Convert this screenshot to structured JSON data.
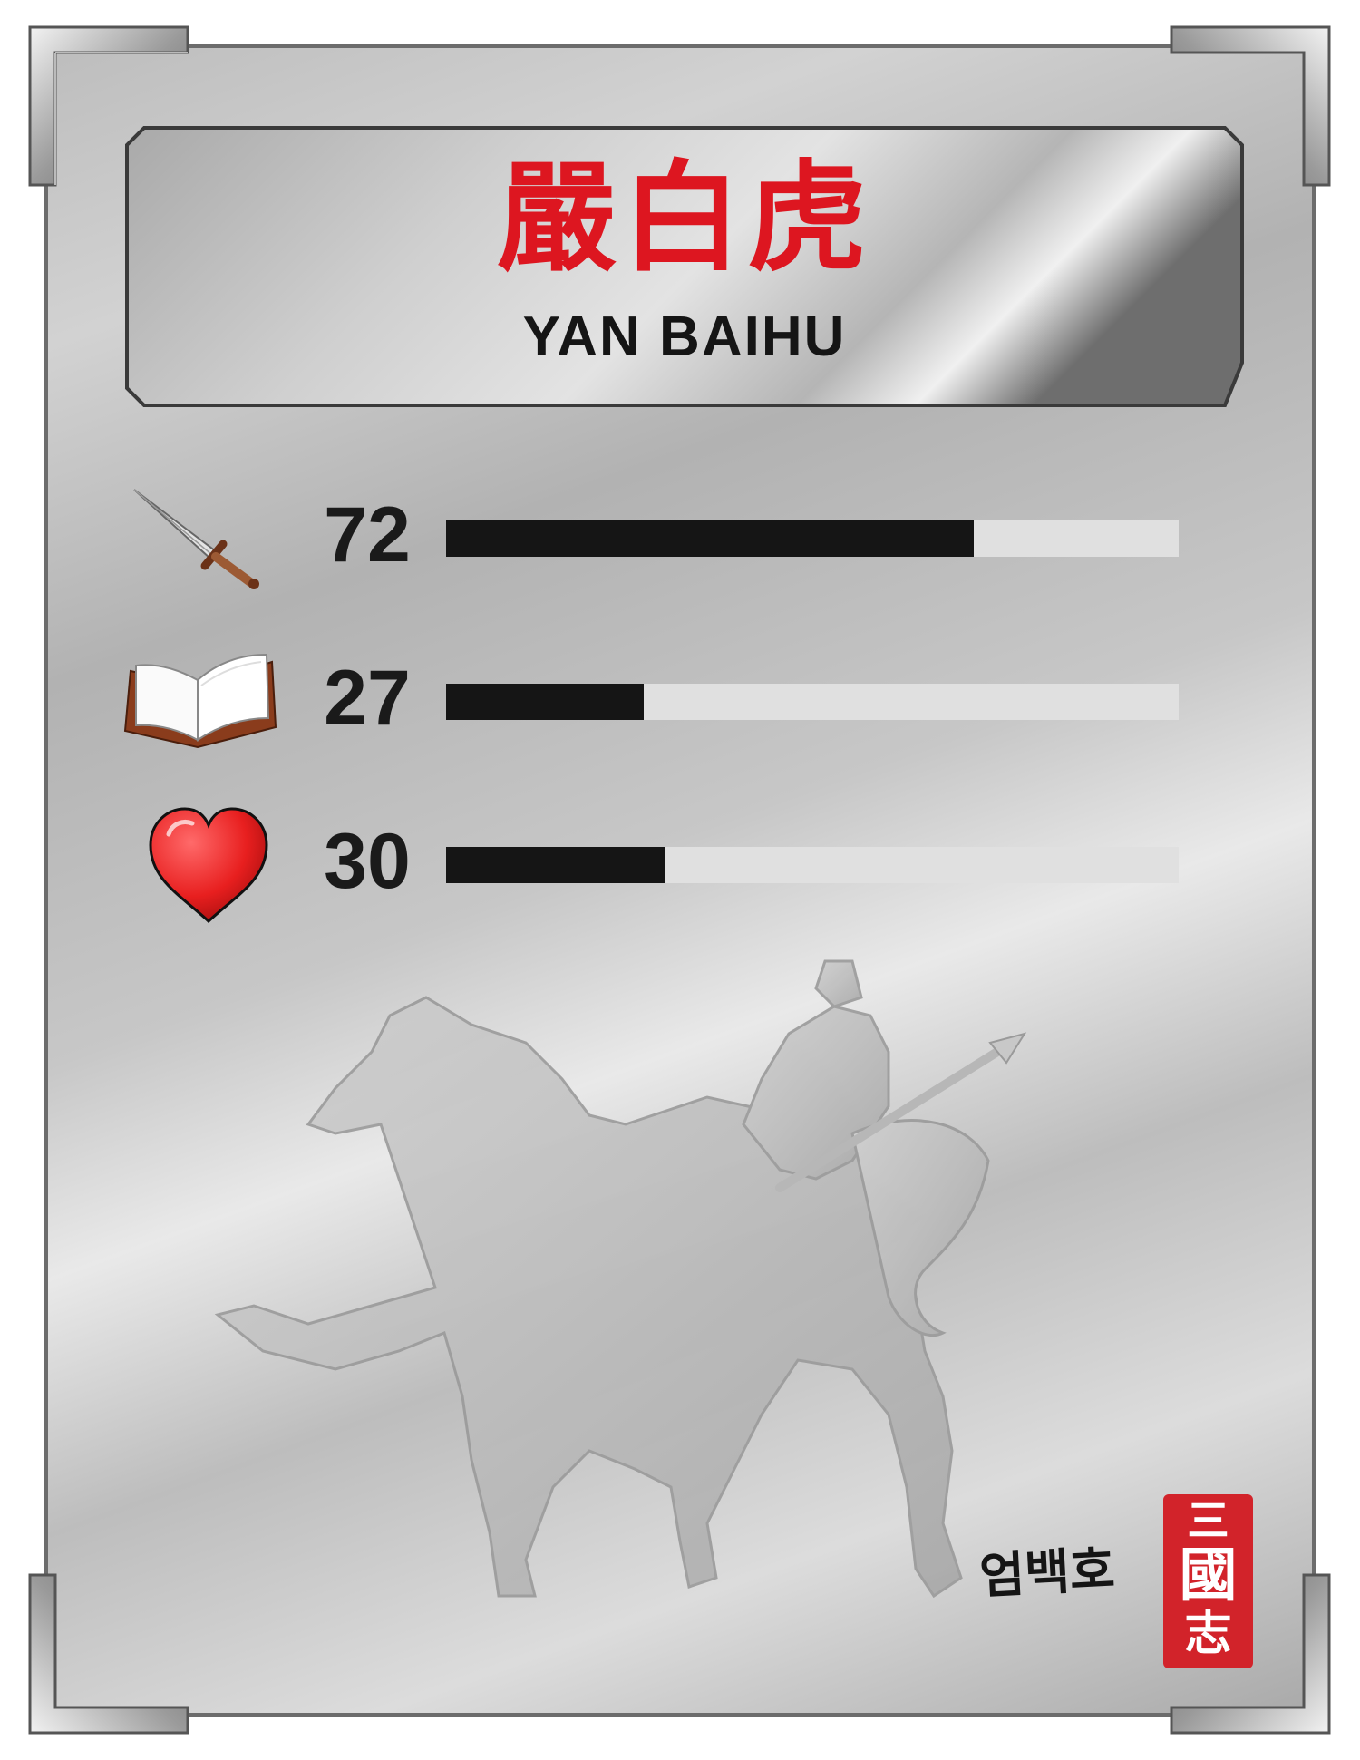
{
  "card": {
    "name_cn": "嚴白虎",
    "name_en": "YAN BAIHU",
    "name_ko": "엄백호",
    "seal_text": "三國志"
  },
  "stats": [
    {
      "key": "war",
      "icon": "sword-icon",
      "value": "72",
      "fraction": 0.72
    },
    {
      "key": "intelligence",
      "icon": "book-icon",
      "value": "27",
      "fraction": 0.27
    },
    {
      "key": "charm",
      "icon": "heart-icon",
      "value": "30",
      "fraction": 0.3
    }
  ],
  "colors": {
    "title_red": "#dd1620",
    "bar_fill": "#151515",
    "bar_track": "#e0e0e0",
    "heart": "#e81f1f",
    "seal": "#d2232a",
    "frame": "#6c6c6c"
  },
  "emblem": "horse-rider-silhouette"
}
